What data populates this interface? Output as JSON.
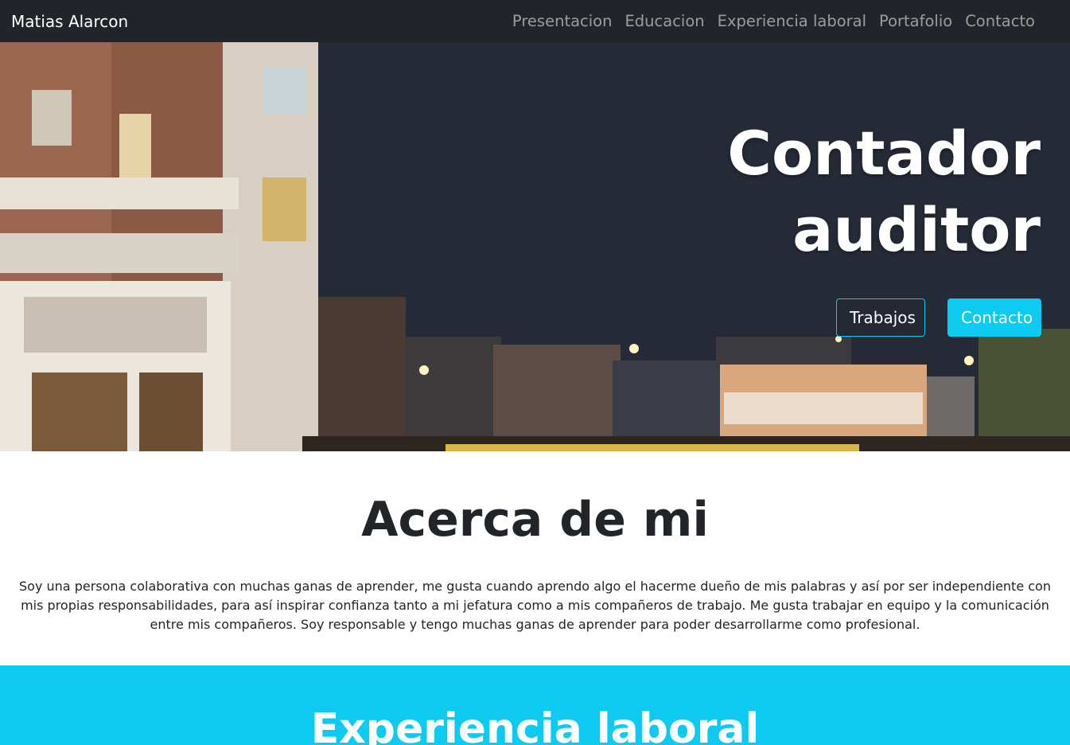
{
  "navbar": {
    "brand": "Matias Alarcon",
    "links": [
      "Presentacion",
      "Educacion",
      "Experiencia laboral",
      "Portafolio",
      "Contacto"
    ]
  },
  "hero": {
    "title_line1": "Contador",
    "title_line2": "auditor",
    "buttons": {
      "jobs": "Trabajos",
      "contact": "Contacto"
    }
  },
  "about": {
    "title": "Acerca de mi",
    "text": "Soy una persona colaborativa con muchas ganas de aprender, me gusta cuando aprendo algo el hacerme dueño de mis palabras y así por ser independiente con mis propias responsabilidades, para así inspirar confianza tanto a mi jefatura como a mis compañeros de trabajo. Me gusta trabajar en equipo y la comunicación entre mis compañeros. Soy responsable y tengo muchas ganas de aprender para poder desarrollarme como profesional."
  },
  "experience": {
    "title": "Experiencia laboral"
  },
  "colors": {
    "navbar_bg": "#212529",
    "accent": "#0dcaf0",
    "text": "#212529"
  }
}
